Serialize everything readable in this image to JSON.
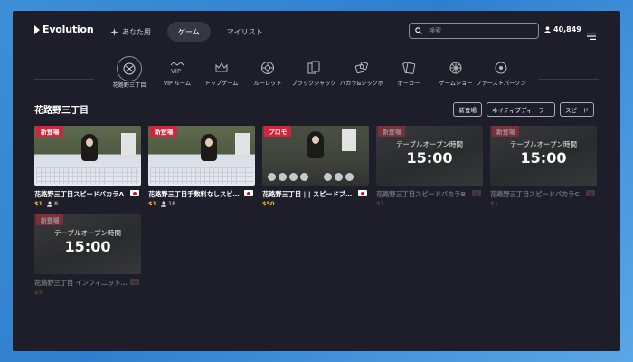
{
  "header": {
    "logo": "Evolution",
    "nav": [
      {
        "label": "あなた用",
        "active": false
      },
      {
        "label": "ゲーム",
        "active": true
      },
      {
        "label": "マイリスト",
        "active": false
      }
    ],
    "search_placeholder": "検索",
    "balance": "40,849"
  },
  "categories": [
    {
      "label": "花路野三丁目",
      "icon": "logo-icon",
      "selected": true
    },
    {
      "label": "VIP ルーム",
      "icon": "vip-icon",
      "selected": false
    },
    {
      "label": "トップゲーム",
      "icon": "crown-icon",
      "selected": false
    },
    {
      "label": "ルーレット",
      "icon": "roulette-icon",
      "selected": false
    },
    {
      "label": "ブラックジャック",
      "icon": "cards-icon",
      "selected": false
    },
    {
      "label": "バカラ&シックボ",
      "icon": "dice-icon",
      "selected": false
    },
    {
      "label": "ポーカー",
      "icon": "poker-icon",
      "selected": false
    },
    {
      "label": "ゲームショー",
      "icon": "wheel-icon",
      "selected": false
    },
    {
      "label": "ファーストパーソン",
      "icon": "first-person-icon",
      "selected": false
    }
  ],
  "section": {
    "title": "花路野三丁目",
    "filters": [
      "新登場",
      "ネイティブディーラー",
      "スピード"
    ]
  },
  "games": [
    {
      "name": "花路野三丁目スピードバカラA",
      "badge": "新登場",
      "price": "$1",
      "players": "8",
      "status": "live"
    },
    {
      "name": "花路野三丁目手数料なしスピ…",
      "badge": "新登場",
      "price": "$1",
      "players": "18",
      "status": "live"
    },
    {
      "name": "花路野三丁目 ||| スピードブ…",
      "badge": "プロモ",
      "price": "$50",
      "players": "",
      "status": "live"
    },
    {
      "name": "花路野三丁目スピードバカラB",
      "badge": "新登場",
      "price": "$1",
      "players": "",
      "status": "closed",
      "closed_text": "テーブルオープン時間",
      "open_time": "15:00"
    },
    {
      "name": "花路野三丁目スピードバカラC",
      "badge": "新登場",
      "price": "$1",
      "players": "",
      "status": "closed",
      "closed_text": "テーブルオープン時間",
      "open_time": "15:00"
    },
    {
      "name": "花路野三丁目 インフィニット…",
      "badge": "新登場",
      "price": "$5",
      "players": "",
      "status": "closed",
      "closed_text": "テーブルオープン時間",
      "open_time": "15:00"
    }
  ],
  "colors": {
    "background": "#1d1e29",
    "badge": "#d4233a",
    "price": "#f0b429",
    "page": "#3d8fd6"
  }
}
